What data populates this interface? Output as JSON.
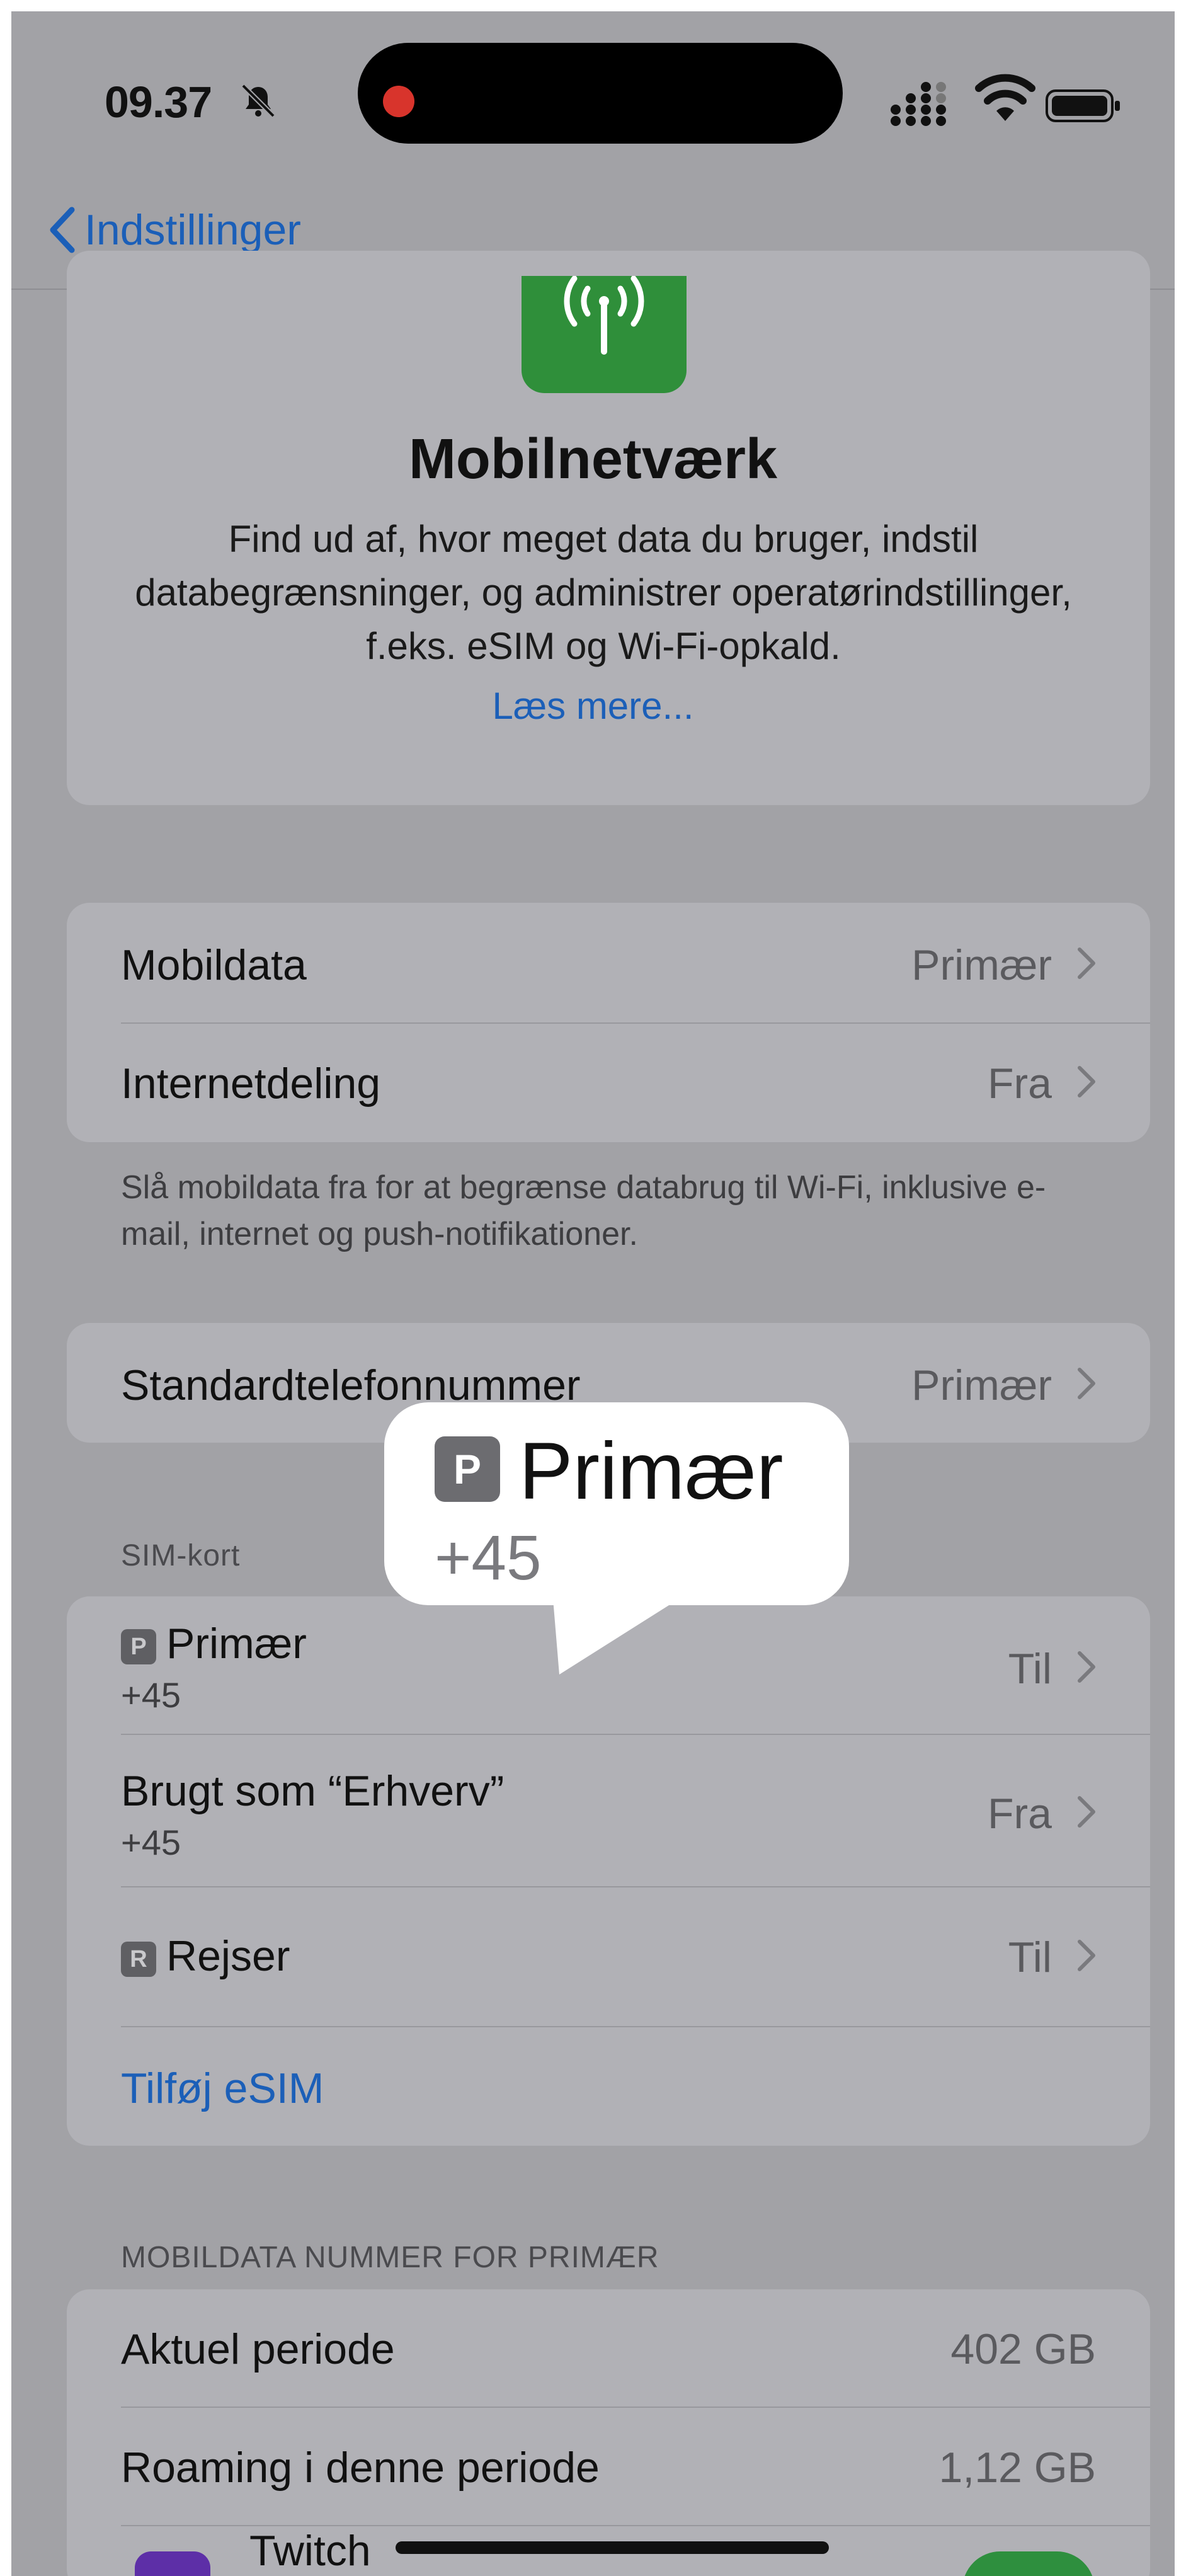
{
  "status_bar": {
    "time": "09.37",
    "icons": [
      "bell-slash-icon",
      "recording-dot-icon",
      "cellular-signal-icon",
      "wifi-icon",
      "battery-icon"
    ]
  },
  "nav": {
    "back_label": "Indstillinger",
    "back_icon": "chevron-left-icon"
  },
  "info": {
    "icon": "antenna-icon",
    "title": "Mobilnetværk",
    "body": "Find ud af, hvor meget data du bruger, indstil databegrænsninger, og administrer operatørindstillinger, f.eks. eSIM og Wi-Fi-opkald.",
    "link": "Læs mere..."
  },
  "data_group": {
    "rows": [
      {
        "label": "Mobildata",
        "value": "Primær"
      },
      {
        "label": "Internetdeling",
        "value": "Fra"
      }
    ],
    "footer": "Slå mobildata fra for at begrænse databrug til Wi-Fi, inklusive e-mail, internet og push-notifikationer."
  },
  "default_number": {
    "label": "Standardtelefonnummer",
    "value": "Primær"
  },
  "sim_section": {
    "header": "SIM-kort",
    "rows": [
      {
        "badge": "P",
        "label": "Primær",
        "sub": "+45",
        "value": "Til"
      },
      {
        "label": "Brugt som “Erhverv”",
        "sub": "+45",
        "value": "Fra"
      },
      {
        "badge": "R",
        "label": "Rejser",
        "value": "Til"
      }
    ],
    "add_esim": "Tilføj eSIM"
  },
  "tooltip": {
    "badge": "P",
    "title": "Primær",
    "sub": "+45"
  },
  "usage_section": {
    "header": "MOBILDATA NUMMER FOR PRIMÆR",
    "rows": [
      {
        "label": "Aktuel periode",
        "value": "402 GB"
      },
      {
        "label": "Roaming i denne periode",
        "value": "1,12 GB"
      }
    ],
    "app_row": {
      "label": "Twitch",
      "toggle_on": true
    }
  },
  "colors": {
    "accent": "#1b5fb8",
    "toggle_on": "#2e8f3e",
    "app_icon": "#2f8f3a",
    "twitch": "#5d2fa7"
  }
}
